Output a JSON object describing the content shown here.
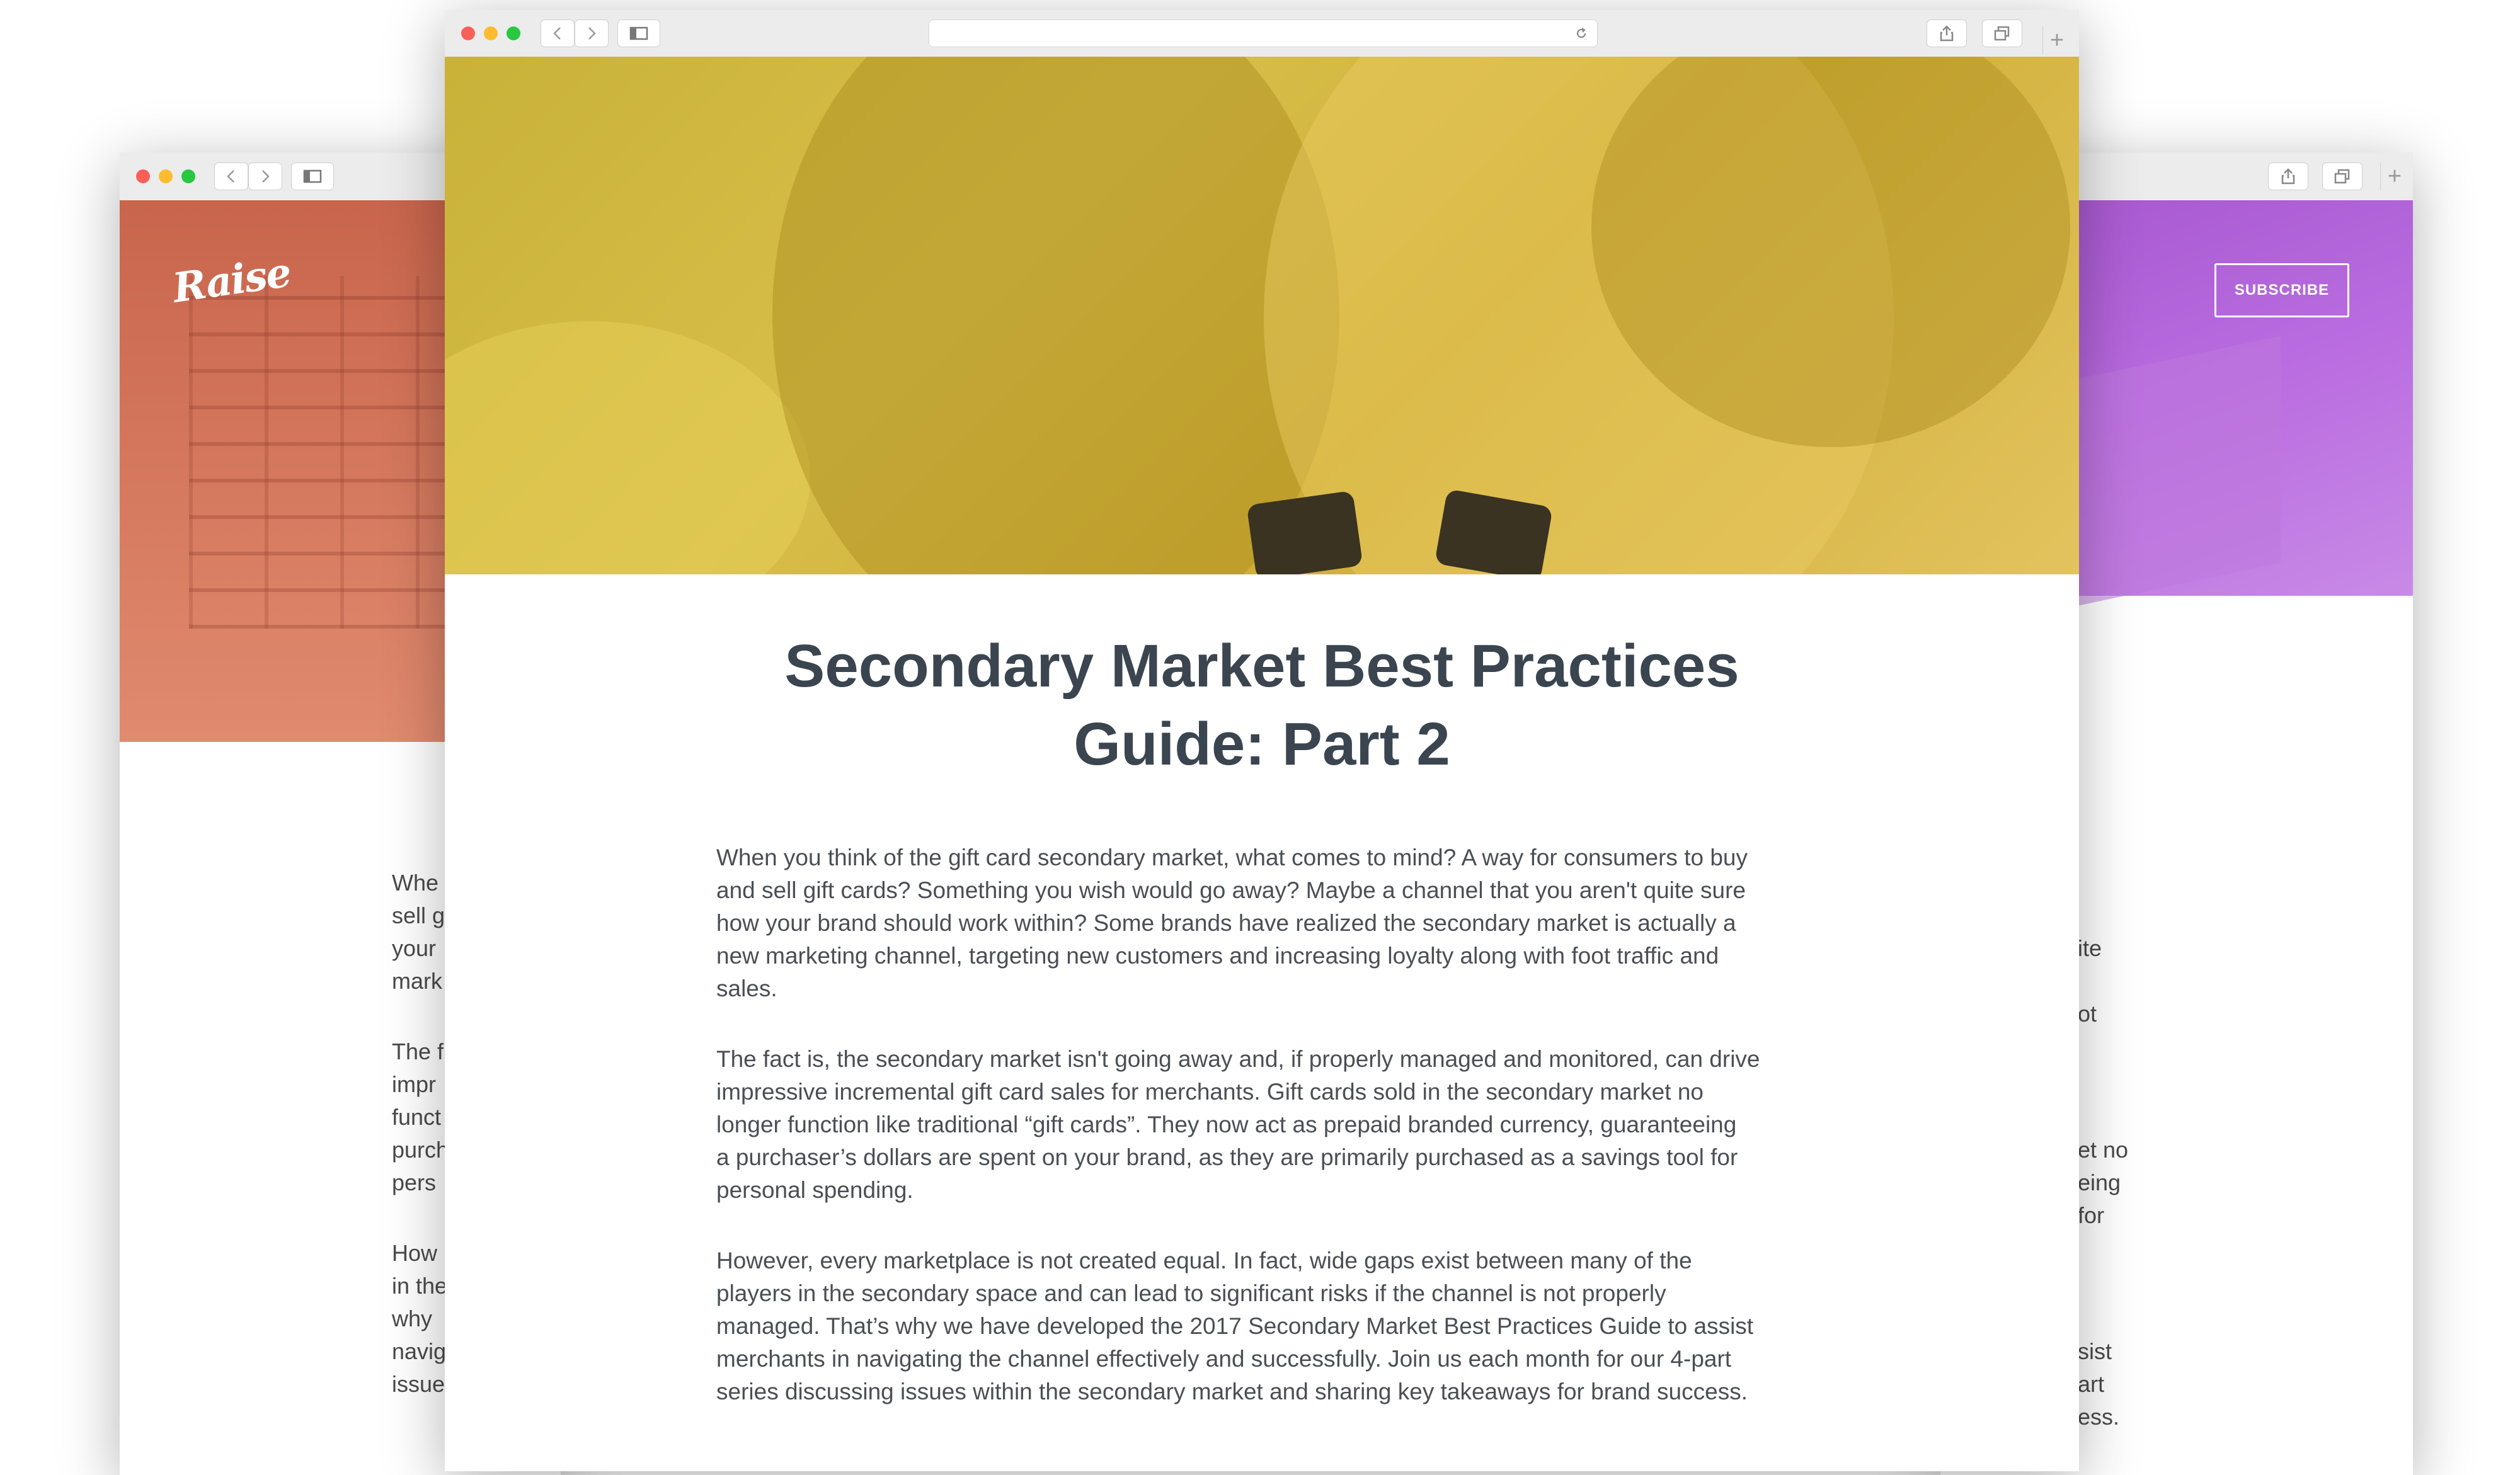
{
  "left_window": {
    "logo": "Raise",
    "text_fragments": [
      "Whe",
      "sell g",
      "your",
      "mark",
      "The f",
      "impr",
      "funct",
      "purch",
      "pers",
      "How",
      "in the",
      "why",
      "navig",
      "issue"
    ]
  },
  "right_window": {
    "subscribe_label": "SUBSCRIBE",
    "text_fragments": [
      "ite",
      "ot",
      "et no",
      "eing",
      "for",
      "sist",
      "art",
      "ess."
    ]
  },
  "main_window": {
    "title_line1": "Secondary Market Best Practices",
    "title_line2": "Guide: Part 2",
    "paragraphs": [
      [
        "When you think of the gift card secondary market, what comes to mind? A way for consumers to buy",
        "and sell gift cards? Something you wish would go away? Maybe a channel that you aren't quite sure",
        "how your brand should work within? Some brands have realized the secondary market is actually a",
        "new marketing channel, targeting new customers and increasing loyalty along with foot traffic and",
        "sales."
      ],
      [
        "The fact is, the secondary market isn't going away and, if properly managed and monitored, can drive",
        "impressive incremental gift card sales for merchants. Gift cards sold in the secondary market no",
        "longer function like traditional “gift cards”.  They now act as prepaid branded currency, guaranteeing",
        "a purchaser’s dollars are spent on your brand, as they are primarily purchased as a savings tool for",
        "personal spending."
      ],
      [
        "However, every marketplace is not created equal. In fact, wide gaps exist between many of the",
        "players in the secondary space and can lead to significant risks if the channel is not properly",
        "managed. That’s why we have developed the 2017 Secondary Market Best Practices Guide to assist",
        "merchants in navigating the channel effectively and successfully. Join us each month for our 4-part",
        "series discussing issues within the secondary market and sharing key takeaways for brand success."
      ]
    ]
  }
}
